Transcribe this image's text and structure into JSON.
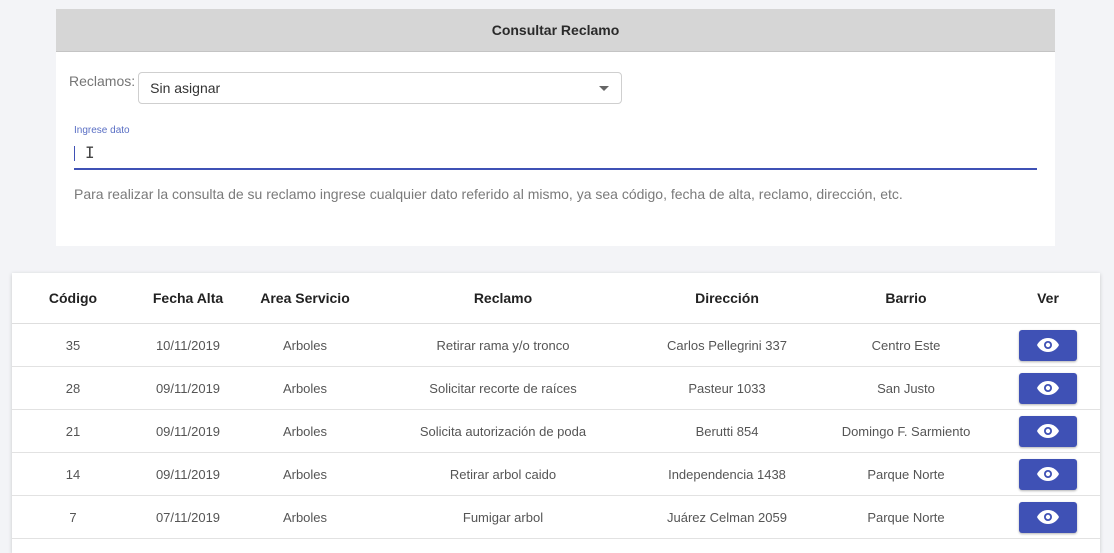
{
  "card": {
    "title": "Consultar Reclamo",
    "select_label": "Reclamos:",
    "select_value": "Sin asignar",
    "input_label": "Ingrese dato",
    "input_value": "",
    "helper_text": "Para realizar la consulta de su reclamo ingrese cualquier dato referido al mismo, ya sea código, fecha de alta, reclamo, dirección, etc."
  },
  "table": {
    "headers": [
      "Código",
      "Fecha Alta",
      "Area Servicio",
      "Reclamo",
      "Dirección",
      "Barrio",
      "Ver"
    ],
    "rows": [
      {
        "codigo": "35",
        "fecha": "10/11/2019",
        "area": "Arboles",
        "reclamo": "Retirar rama y/o tronco",
        "direccion": "Carlos Pellegrini 337",
        "barrio": "Centro Este"
      },
      {
        "codigo": "28",
        "fecha": "09/11/2019",
        "area": "Arboles",
        "reclamo": "Solicitar recorte de raíces",
        "direccion": "Pasteur 1033",
        "barrio": "San Justo"
      },
      {
        "codigo": "21",
        "fecha": "09/11/2019",
        "area": "Arboles",
        "reclamo": "Solicita autorización de poda",
        "direccion": "Berutti 854",
        "barrio": "Domingo F. Sarmiento"
      },
      {
        "codigo": "14",
        "fecha": "09/11/2019",
        "area": "Arboles",
        "reclamo": "Retirar arbol caido",
        "direccion": "Independencia 1438",
        "barrio": "Parque Norte"
      },
      {
        "codigo": "7",
        "fecha": "07/11/2019",
        "area": "Arboles",
        "reclamo": "Fumigar arbol",
        "direccion": "Juárez Celman 2059",
        "barrio": "Parque Norte"
      }
    ],
    "view_icon": "eye-icon"
  },
  "colors": {
    "primary": "#3f51b5",
    "header_bg": "#d6d6d6",
    "page_bg": "#f3f4f7"
  }
}
